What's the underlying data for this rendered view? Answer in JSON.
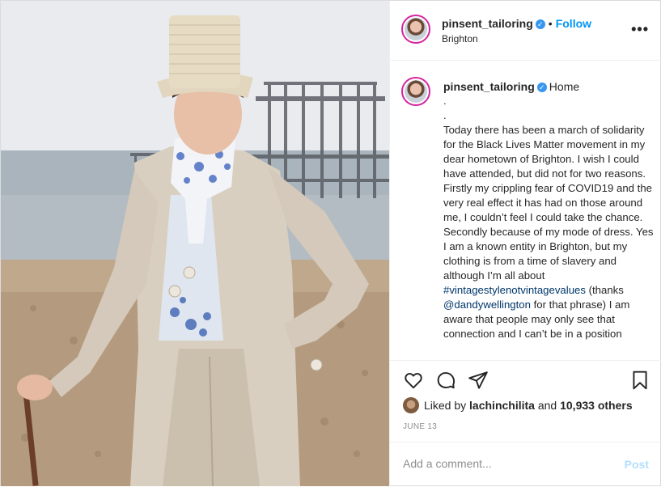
{
  "post": {
    "username": "pinsent_tailoring",
    "verified_icon": "verified-badge-icon",
    "separator": "•",
    "follow_label": "Follow",
    "location": "Brighton",
    "more_icon": "more-options-icon",
    "more_label": "•••"
  },
  "caption": {
    "username": "pinsent_tailoring",
    "home": "Home",
    "lines": [
      ".",
      "."
    ],
    "text_1": "Today there has been a march of solidarity for the Black Lives Matter movement in my dear hometown of Brighton. I wish I could have attended, but did not for two reasons. Firstly my crippling fear of COVID19 and the very real effect it has had on those around me, I couldn’t feel I could take the chance. Secondly because of my mode of dress. Yes I am a known entity in Brighton, but my clothing is from a time of slavery and although I’m all about ",
    "hashtag": "#vintagestylenotvintagevalues",
    "text_2": " (thanks ",
    "mention": "@dandywellington",
    "text_3": " for that phrase) I am aware that people may only see that connection and I can’t be in a position"
  },
  "actions": {
    "icons": [
      "heart-icon",
      "comment-icon",
      "share-icon",
      "bookmark-icon"
    ]
  },
  "likes": {
    "prefix": "Liked by",
    "user": "lachinchilita",
    "and": "and",
    "others": "10,933 others"
  },
  "date": "JUNE 13",
  "comment": {
    "placeholder": "Add a comment...",
    "post_label": "Post"
  },
  "colors": {
    "link_blue": "#0095f6",
    "verified_blue": "#3897f0",
    "hashtag": "#00376b",
    "post_disabled": "#b2dffc",
    "story_ring": "#d6249f"
  }
}
